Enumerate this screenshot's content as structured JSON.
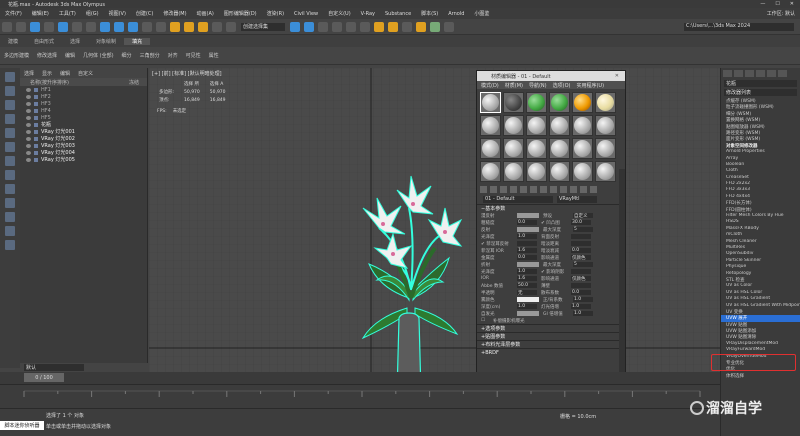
{
  "window": {
    "title": "花瓶.max - Autodesk 3ds Max Olympus",
    "min": "—",
    "max": "☐",
    "close": "✕"
  },
  "menu": [
    "文件(F)",
    "编辑(E)",
    "工具(T)",
    "组(G)",
    "视图(V)",
    "创建(C)",
    "修改器(M)",
    "动画(A)",
    "图形编辑器(D)",
    "渲染(R)",
    "Civil View",
    "自定义(U)",
    "V-Ray",
    "Substance",
    "脚本(S)",
    "Arnold",
    "小图鉴",
    "工作区: 默认"
  ],
  "toolbar": {
    "selection_set": "创建选择集",
    "workspace": "C:\\Users\\...\\3ds Max 2024"
  },
  "ribbon_tabs": [
    "建模",
    "自由形式",
    "选择",
    "对象绘制",
    "填充"
  ],
  "ribbon_items": [
    "多边形建模",
    "修改选择",
    "编辑",
    "几何体 (全部)",
    "细分",
    "三角剖分",
    "对齐",
    "可见性",
    "属性"
  ],
  "scene": {
    "tabs": [
      "选择",
      "显示",
      "编辑",
      "自定义"
    ],
    "header": "名称(按升序排序)",
    "header_right": "冻结",
    "items": [
      {
        "label": "HF1",
        "selected": false
      },
      {
        "label": "HF2",
        "selected": false
      },
      {
        "label": "HF3",
        "selected": false
      },
      {
        "label": "HF4",
        "selected": false
      },
      {
        "label": "HF5",
        "selected": false
      },
      {
        "label": "花瓶",
        "selected": true
      },
      {
        "label": "VRay 灯光001",
        "selected": true
      },
      {
        "label": "VRay 灯光002",
        "selected": true
      },
      {
        "label": "VRay 灯光003",
        "selected": true
      },
      {
        "label": "VRay 灯光004",
        "selected": true
      },
      {
        "label": "VRay 灯光005",
        "selected": true
      }
    ],
    "layer": "默认"
  },
  "viewport": {
    "label": "[+] [前] [标准] [默认明暗处理]",
    "stats_header": [
      "",
      "选择 所",
      "选择 A"
    ],
    "stats": [
      [
        "多边形:",
        "50,970",
        "50,970"
      ],
      [
        "顶点:",
        "16,849",
        "16,849"
      ]
    ],
    "fps_label": "FPS:",
    "fps_value": "未选定"
  },
  "material_editor": {
    "title": "材质编辑器 - 01 - Default",
    "menu": [
      "模式(D)",
      "材质(M)",
      "导航(N)",
      "选项(O)",
      "实用程序(U)"
    ],
    "material_name": "01 - Default",
    "material_type": "VRayMtl",
    "section_basic": "基本参数",
    "params": [
      {
        "label": "漫反射",
        "swatch": "gray",
        "label2": "预设",
        "value2": "自定义"
      },
      {
        "label": "粗糙度",
        "value": "0.0",
        "label2": "✔ 凹凸图",
        "value2": "30.0"
      },
      {
        "label": "反射",
        "swatch": "black",
        "label2": "最大深度",
        "value2": "5"
      },
      {
        "label": "光泽度",
        "value": "1.0",
        "label2": "背面反射",
        "value2": ""
      },
      {
        "label": "✔ 菲涅耳反射",
        "value": "",
        "label2": "暗淡距离",
        "value2": ""
      },
      {
        "label": "菲涅耳 IOR",
        "value": "1.6",
        "label2": "暗淡衰减",
        "value2": "0.0"
      },
      {
        "label": "金属度",
        "value": "0.0",
        "label2": "影响通道",
        "value2": "仅颜色"
      },
      {
        "label": "折射",
        "swatch": "black",
        "label2": "最大深度",
        "value2": "5"
      },
      {
        "label": "光泽度",
        "value": "1.0",
        "label2": "✔ 影响阴影",
        "value2": ""
      },
      {
        "label": "IOR",
        "value": "1.6",
        "label2": "影响通道",
        "value2": "仅颜色"
      },
      {
        "label": "Abbe 数值",
        "value": "50.0",
        "label2": "薄壁",
        "value2": ""
      },
      {
        "label": "半透明",
        "value": "无",
        "label2": "散布系数",
        "value2": "0.0"
      },
      {
        "label": "雾颜色",
        "swatch": "white",
        "label2": "正/背系数",
        "value2": "1.0"
      },
      {
        "label": "深度(cm)",
        "value": "1.0",
        "label2": "灯光倍增",
        "value2": "1.0"
      },
      {
        "label": "自发光",
        "swatch": "black",
        "label2": "GI  倍增值",
        "value2": "1.0"
      }
    ],
    "check_extra": "补偿摄影机曝光",
    "sections": [
      "选项参数",
      "贴图参数",
      "布料光泽层参数",
      "BRDF"
    ]
  },
  "command_panel": {
    "dropdown": "花瓶",
    "list_label": "修改器列表",
    "modifiers": [
      {
        "label": "点缓存 (WSM)",
        "type": "normal"
      },
      {
        "label": "粒子流碰撞图形 (WSM)",
        "type": "normal"
      },
      {
        "label": "细分 (WSM)",
        "type": "normal"
      },
      {
        "label": "置换网格 (WSM)",
        "type": "normal"
      },
      {
        "label": "贴图缩放器 (WSM)",
        "type": "normal"
      },
      {
        "label": "路径变形 (WSM)",
        "type": "normal"
      },
      {
        "label": "面片变形 (WSM)",
        "type": "normal"
      },
      {
        "label": "对象空间修改器",
        "type": "head"
      },
      {
        "label": "Arnold Properties",
        "type": "normal"
      },
      {
        "label": "Array",
        "type": "normal"
      },
      {
        "label": "Boolean",
        "type": "normal"
      },
      {
        "label": "Cloth",
        "type": "normal"
      },
      {
        "label": "CreaseSet",
        "type": "normal"
      },
      {
        "label": "FFD 2x2x2",
        "type": "normal"
      },
      {
        "label": "FFD 3x3x3",
        "type": "normal"
      },
      {
        "label": "FFD 4x4x4",
        "type": "normal"
      },
      {
        "label": "FFD(长方体)",
        "type": "normal"
      },
      {
        "label": "FFD(圆柱体)",
        "type": "normal"
      },
      {
        "label": "Filter Mesh Colors By Hue",
        "type": "normal"
      },
      {
        "label": "HSDS",
        "type": "normal"
      },
      {
        "label": "MassFX RBody",
        "type": "normal"
      },
      {
        "label": "mCloth",
        "type": "normal"
      },
      {
        "label": "Mesh Cleaner",
        "type": "normal"
      },
      {
        "label": "MultiRes",
        "type": "normal"
      },
      {
        "label": "OpenSubdiv",
        "type": "normal"
      },
      {
        "label": "Particle Skinner",
        "type": "normal"
      },
      {
        "label": "Physique",
        "type": "normal"
      },
      {
        "label": "Retopology",
        "type": "normal"
      },
      {
        "label": "STL 检查",
        "type": "normal"
      },
      {
        "label": "UV as Color",
        "type": "normal"
      },
      {
        "label": "UV as HSL Color",
        "type": "normal"
      },
      {
        "label": "UV as HSL Gradient",
        "type": "normal"
      },
      {
        "label": "UV as HSL Gradient With Midpoint",
        "type": "normal"
      },
      {
        "label": "UV 变换",
        "type": "normal"
      },
      {
        "label": "UVW 展开",
        "type": "hl"
      },
      {
        "label": "UVW 贴图",
        "type": "normal"
      },
      {
        "label": "UVW 贴图添加",
        "type": "normal"
      },
      {
        "label": "UVW 贴图清除",
        "type": "normal"
      },
      {
        "label": "VRayDisplacementMod",
        "type": "normal"
      },
      {
        "label": "VRayFurwardMod",
        "type": "normal"
      },
      {
        "label": "VRayOverrideMod",
        "type": "normal"
      },
      {
        "label": "专业优化",
        "type": "normal"
      },
      {
        "label": "优化",
        "type": "normal"
      },
      {
        "label": "体积选择",
        "type": "normal"
      }
    ]
  },
  "timeline": {
    "frame": "0 / 100"
  },
  "status": {
    "max_button": "脚本迷你侦听器",
    "line1": "选择了 1 个 对象",
    "line2": "单击或单击并拖动以选择对象",
    "grid": "栅格 = 10.0cm"
  },
  "watermark": "溜溜自学"
}
